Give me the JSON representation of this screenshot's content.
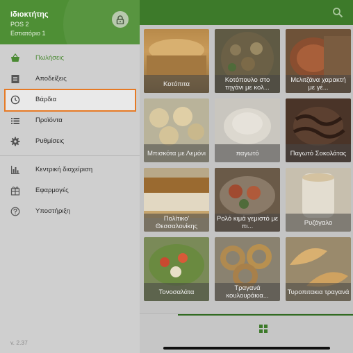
{
  "drawer": {
    "owner": "Ιδιοκτήτης",
    "pos": "POS 2",
    "store": "Εστιατόριο 1",
    "items": [
      {
        "label": "Πωλήσεις",
        "icon": "basket-icon"
      },
      {
        "label": "Αποδείξεις",
        "icon": "receipt-icon"
      },
      {
        "label": "Βάρδια",
        "icon": "clock-icon"
      },
      {
        "label": "Προϊόντα",
        "icon": "list-icon"
      },
      {
        "label": "Ρυθμίσεις",
        "icon": "gear-icon"
      },
      {
        "label": "Κεντρική διαχείριση",
        "icon": "bar-chart-icon"
      },
      {
        "label": "Εφαρμογές",
        "icon": "apps-icon"
      },
      {
        "label": "Υποστήριξη",
        "icon": "help-icon"
      }
    ],
    "version": "v. 2.37"
  },
  "products": [
    {
      "name": "Κοτόπιτα"
    },
    {
      "name": "Κοτόπουλο στο τηγάνι με κολ..."
    },
    {
      "name": "Μελιτζάνα χαρακτή με γέ..."
    },
    {
      "name": "Μπισκότα με Λεμόνι"
    },
    {
      "name": "παγωτό"
    },
    {
      "name": "Παγωτό Σοκολάτας"
    },
    {
      "name": "Πολίτικο' Θεσσαλονίκης"
    },
    {
      "name": "Ρολό κιμά γεμιστό με πι..."
    },
    {
      "name": "Ρυζόγαλο"
    },
    {
      "name": "Τονοσαλάτα"
    },
    {
      "name": "Τραγανά κουλουράκια..."
    },
    {
      "name": "Τυροπιτακια τραγανά"
    }
  ],
  "colors": {
    "brand": "#4e8f35",
    "active": "#4a8a32",
    "highlight": "#e67a25"
  }
}
